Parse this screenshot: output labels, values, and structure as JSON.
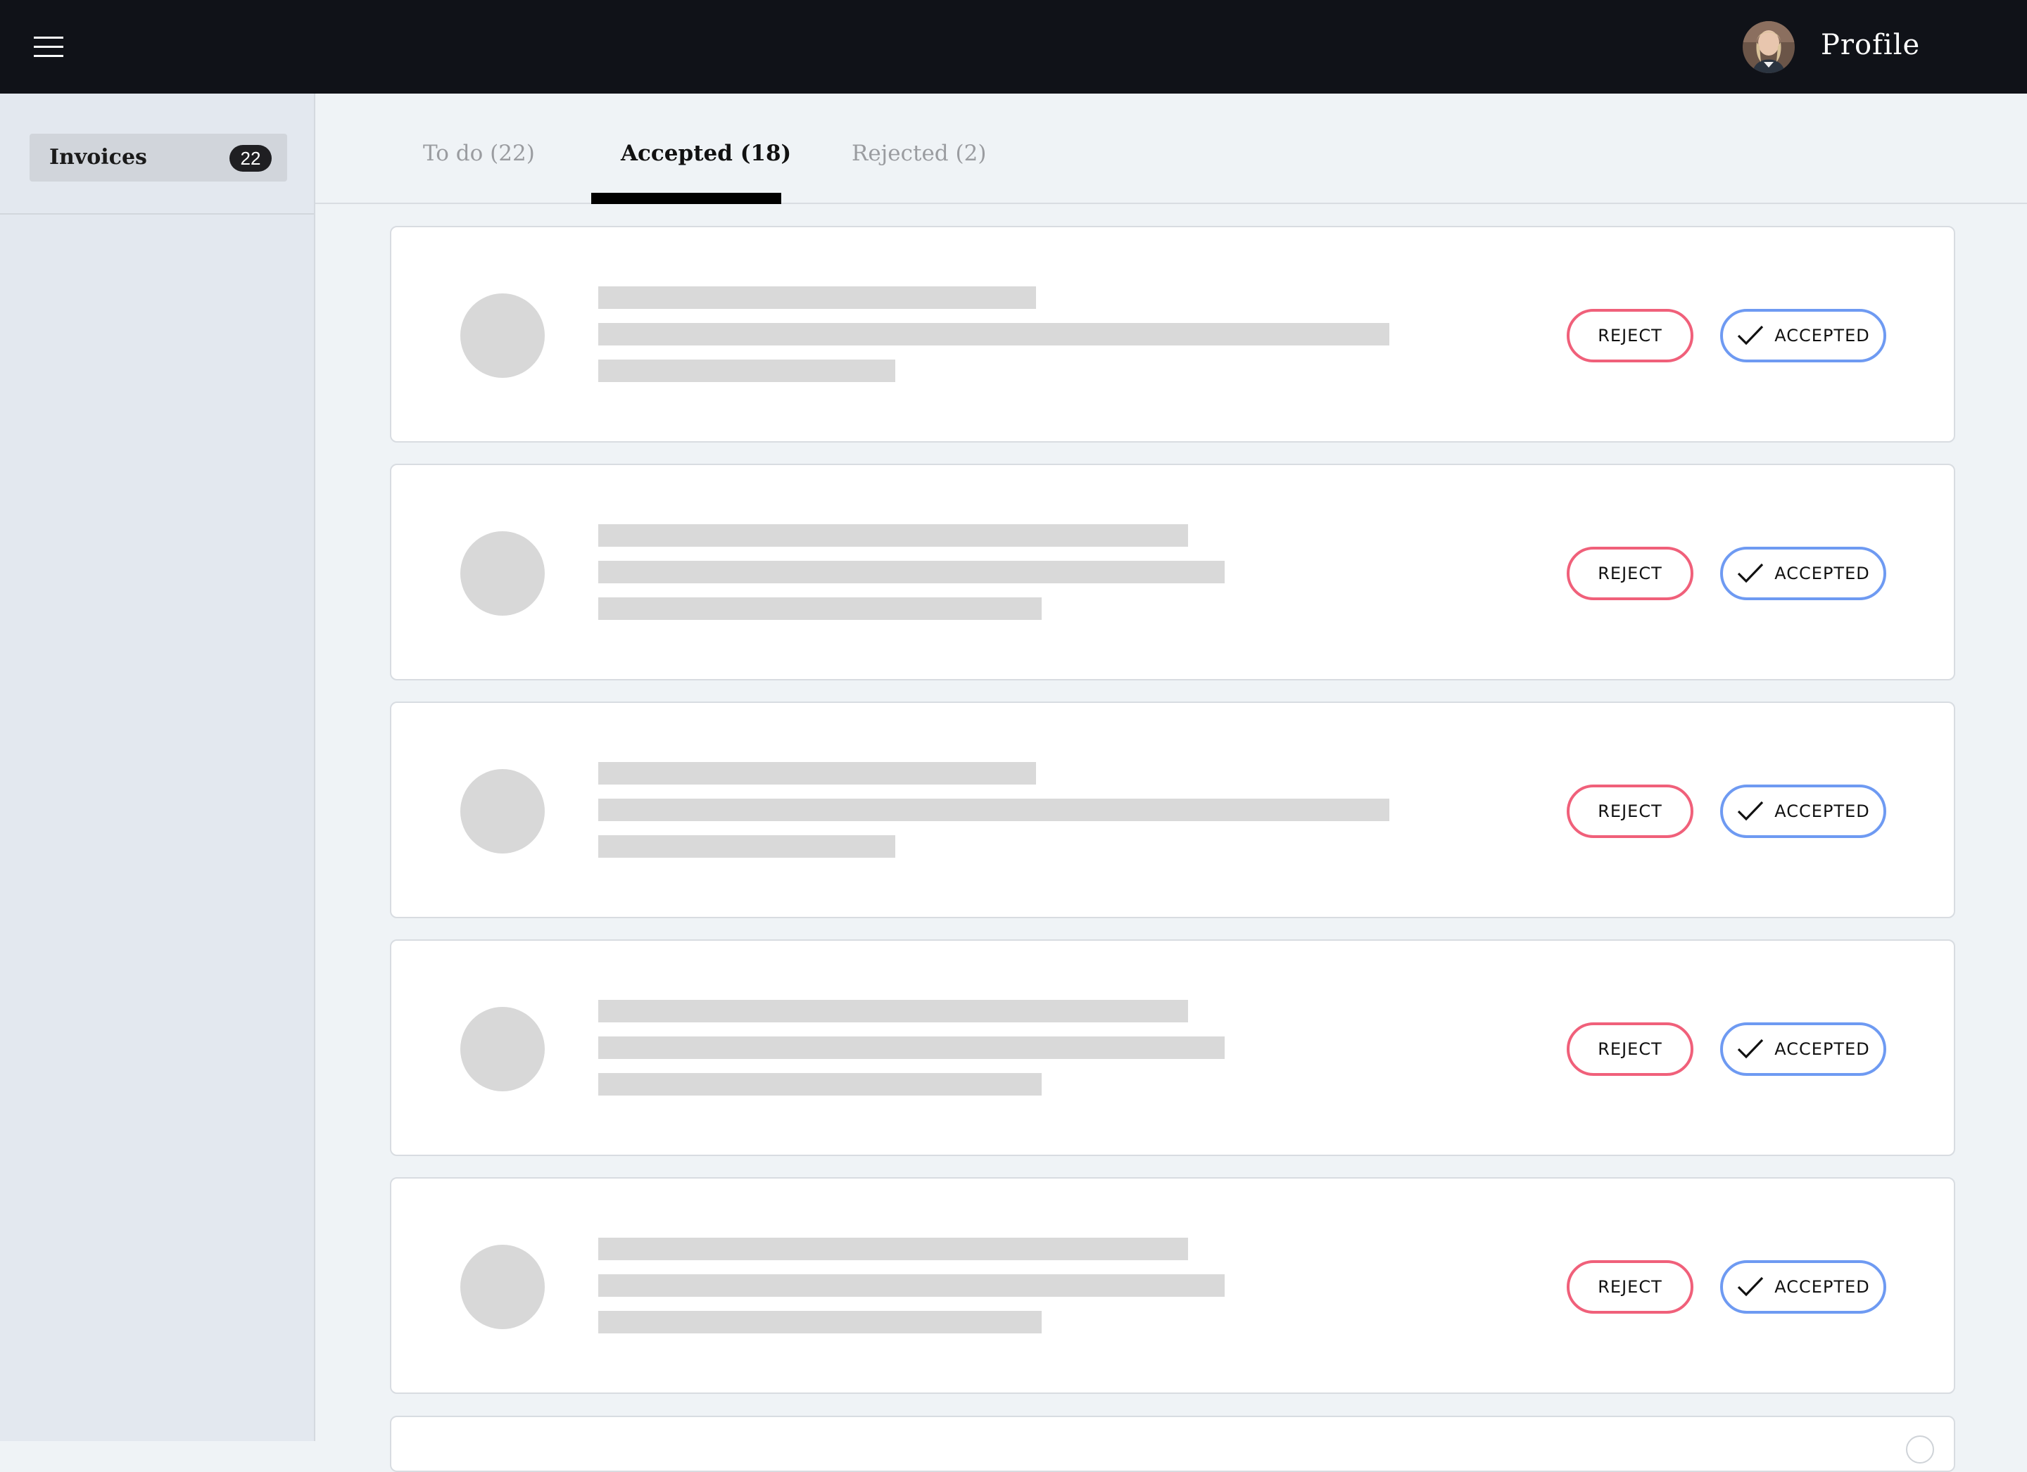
{
  "topbar": {
    "menu_icon": "hamburger-menu-icon",
    "profile_label": "Profile"
  },
  "sidebar": {
    "items": [
      {
        "label": "Invoices",
        "count": "22"
      }
    ]
  },
  "tabs": [
    {
      "label": "To do (22)",
      "active": false
    },
    {
      "label": "Accepted (18)",
      "active": true
    },
    {
      "label": "Rejected (2)",
      "active": false
    }
  ],
  "cards": {
    "reject_label": "REJECT",
    "accepted_label": "ACCEPTED",
    "accepted_icon": "checkmark-icon",
    "count_visible": 5
  },
  "colors": {
    "topbar": "#101218",
    "reject_border": "#f0607a",
    "accepted_border": "#6e9af2",
    "skeleton": "#d9d9d9"
  }
}
